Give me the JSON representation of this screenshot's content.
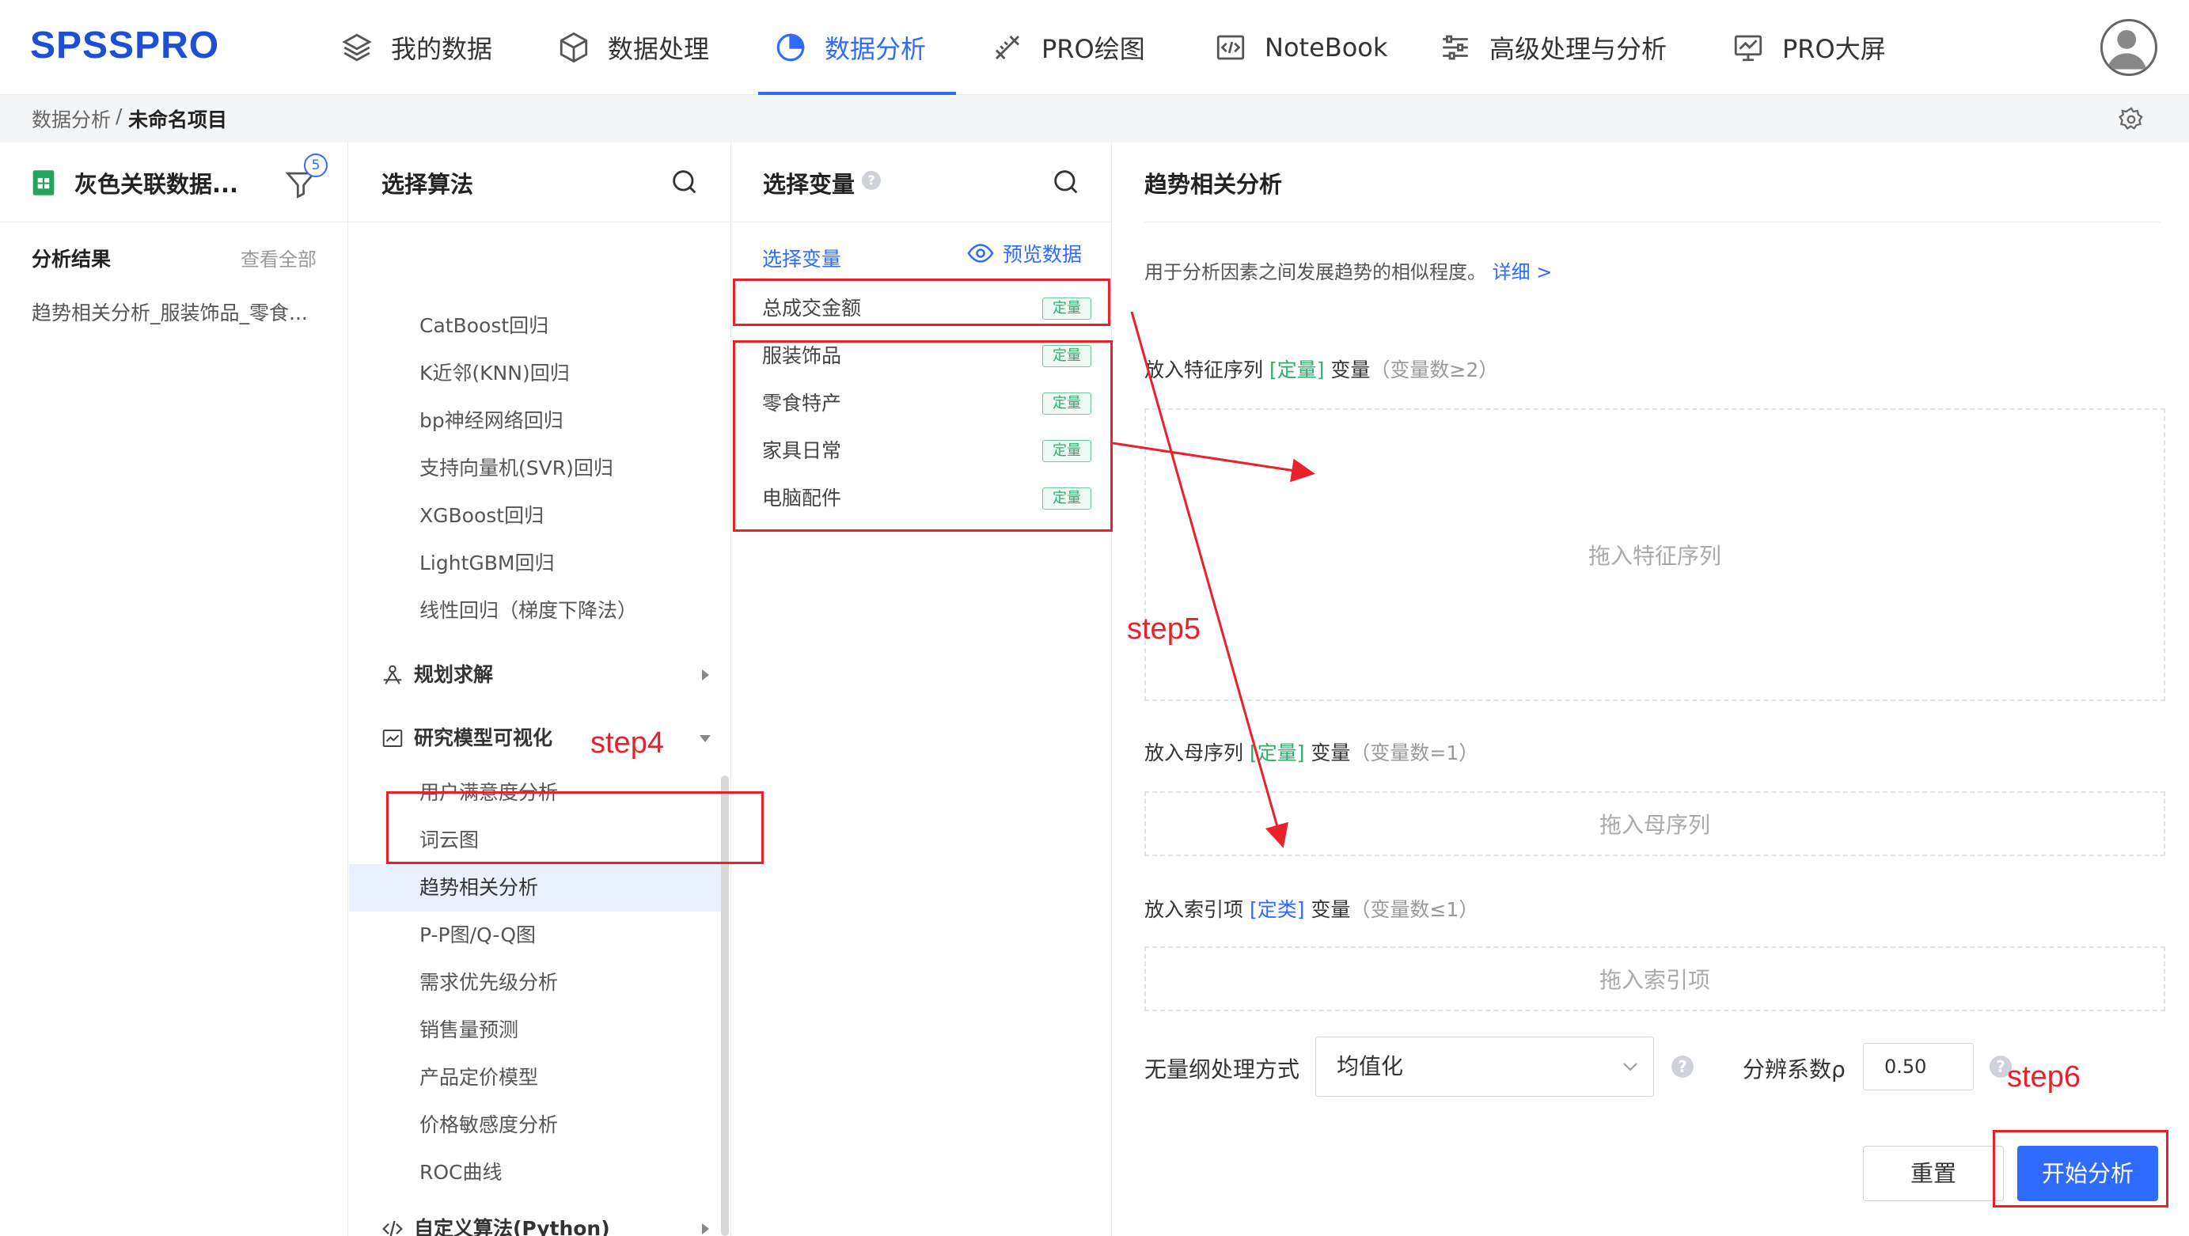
{
  "app": {
    "logo": "SPSSPRO",
    "nav": [
      {
        "label": "我的数据",
        "icon": "layers-icon",
        "active": false
      },
      {
        "label": "数据处理",
        "icon": "cube-icon",
        "active": false
      },
      {
        "label": "数据分析",
        "icon": "pie-chart-icon",
        "active": true
      },
      {
        "label": "PRO绘图",
        "icon": "ruler-pencil-icon",
        "active": false
      },
      {
        "label": "NoteBook",
        "icon": "code-window-icon",
        "active": false
      },
      {
        "label": "高级处理与分析",
        "icon": "sliders-icon",
        "active": false
      },
      {
        "label": "PRO大屏",
        "icon": "monitor-chart-icon",
        "active": false
      }
    ],
    "accent": "#2f6bff"
  },
  "breadcrumb": {
    "root": "数据分析",
    "sep": "/",
    "current": "未命名项目"
  },
  "data_panel": {
    "title": "灰色关联数据...",
    "filter_badge": "5",
    "results_head": "分析结果",
    "results_all": "查看全部",
    "result_item": "趋势相关分析_服装饰品_零食..."
  },
  "algo_panel": {
    "title": "选择算法",
    "top_items": [
      "CatBoost回归",
      "K近邻(KNN)回归",
      "bp神经网络回归",
      "支持向量机(SVR)回归",
      "XGBoost回归",
      "LightGBM回归",
      "线性回归（梯度下降法）"
    ],
    "group_planning": "规划求解",
    "group_visual": "研究模型可视化",
    "visual_items": [
      "用户满意度分析",
      "词云图",
      "趋势相关分析",
      "P-P图/Q-Q图",
      "需求优先级分析",
      "销售量预测",
      "产品定价模型",
      "价格敏感度分析",
      "ROC曲线"
    ],
    "selected": "趋势相关分析",
    "group_custom": "自定义算法(Python)"
  },
  "vars_panel": {
    "title": "选择变量",
    "sub": "选择变量",
    "preview": "预览数据",
    "variables": [
      {
        "name": "总成交金额",
        "tag": "定量"
      },
      {
        "name": "服装饰品",
        "tag": "定量"
      },
      {
        "name": "零食特产",
        "tag": "定量"
      },
      {
        "name": "家具日常",
        "tag": "定量"
      },
      {
        "name": "电脑配件",
        "tag": "定量"
      }
    ]
  },
  "config_panel": {
    "title": "趋势相关分析",
    "desc": "用于分析因素之间发展趋势的相似程度。",
    "detail_link": "详细 >",
    "feature": {
      "prefix": "放入特征序列 ",
      "type": "[定量]",
      "suffix": " 变量",
      "hint": "（变量数≥2）",
      "placeholder": "拖入特征序列"
    },
    "mother": {
      "prefix": "放入母序列 ",
      "type": "[定量]",
      "suffix": " 变量",
      "hint": "（变量数=1）",
      "placeholder": "拖入母序列"
    },
    "index": {
      "prefix": "放入索引项 ",
      "type": "[定类]",
      "suffix": " 变量",
      "hint": "（变量数≤1）",
      "placeholder": "拖入索引项"
    },
    "norm_label": "无量纲处理方式",
    "norm_value": "均值化",
    "rho_label": "分辨系数ρ",
    "rho_value": "0.50",
    "reset": "重置",
    "start": "开始分析"
  },
  "annotations": {
    "step4": "step4",
    "step5": "step5",
    "step6": "step6",
    "color": "#e8212a"
  }
}
